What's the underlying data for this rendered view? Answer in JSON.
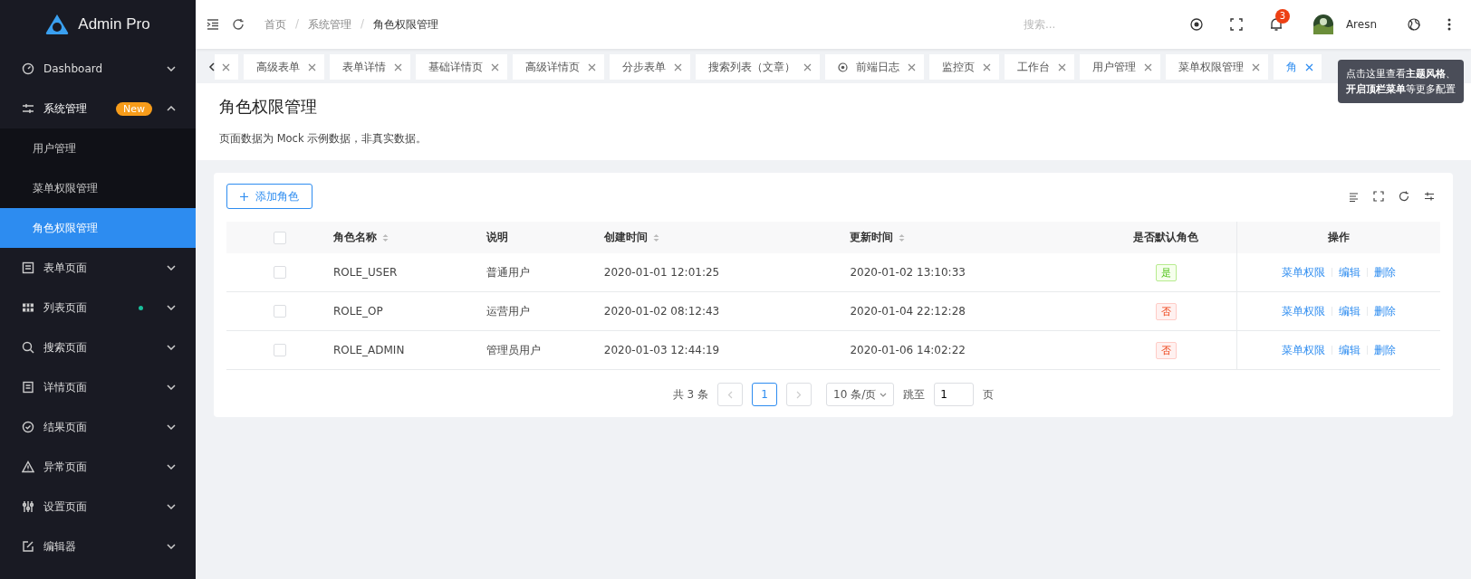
{
  "sidebar": {
    "logo": "Admin Pro",
    "items": [
      {
        "label": "Dashboard",
        "expanded": false
      },
      {
        "label": "系统管理",
        "expanded": true,
        "badge": "New",
        "children": [
          {
            "label": "用户管理",
            "selected": false
          },
          {
            "label": "菜单权限管理",
            "selected": false
          },
          {
            "label": "角色权限管理",
            "selected": true
          }
        ]
      },
      {
        "label": "表单页面",
        "expanded": false
      },
      {
        "label": "列表页面",
        "expanded": false,
        "dot": true
      },
      {
        "label": "搜索页面",
        "expanded": false
      },
      {
        "label": "详情页面",
        "expanded": false
      },
      {
        "label": "结果页面",
        "expanded": false
      },
      {
        "label": "异常页面",
        "expanded": false
      },
      {
        "label": "设置页面",
        "expanded": false
      },
      {
        "label": "编辑器",
        "expanded": false
      }
    ]
  },
  "header": {
    "breadcrumb_separator": "/",
    "breadcrumb": [
      "首页",
      "系统管理",
      "角色权限管理"
    ],
    "search": {
      "placeholder": "搜索..."
    },
    "notification_count": "3",
    "user": "Aresn"
  },
  "tabs": [
    {
      "selected": false
    },
    {
      "label": "高级表单",
      "selected": false
    },
    {
      "label": "表单详情",
      "selected": false
    },
    {
      "label": "基础详情页",
      "selected": false
    },
    {
      "label": "高级详情页",
      "selected": false
    },
    {
      "label": "分步表单",
      "selected": false
    },
    {
      "label": "搜索列表（文章）",
      "selected": false
    },
    {
      "label": "前端日志",
      "selected": false,
      "dot": true
    },
    {
      "label": "监控页",
      "selected": false
    },
    {
      "label": "工作台",
      "selected": false
    },
    {
      "label": "用户管理",
      "selected": false
    },
    {
      "label": "菜单权限管理",
      "selected": false
    },
    {
      "label": "角",
      "selected": true
    }
  ],
  "tooltip": {
    "lines": [
      "点击这里查看**主题风格**、",
      "**开启顶栏菜单**等更多配置"
    ]
  },
  "page": {
    "title": "角色权限管理",
    "description": "页面数据为 Mock 示例数据，非真实数据。"
  },
  "add_button": "添加角色",
  "table": {
    "all_checked": false,
    "columns": [
      {
        "label": "角色名称",
        "sortable": true
      },
      {
        "label": "说明",
        "sortable": false
      },
      {
        "label": "创建时间",
        "sortable": true
      },
      {
        "label": "更新时间",
        "sortable": true
      },
      {
        "label": "是否默认角色",
        "sortable": false
      },
      {
        "label": "操作",
        "sortable": false
      }
    ],
    "rows": [
      {
        "checked": false,
        "name": "ROLE_USER",
        "description": "普通用户",
        "created": "2020-01-01 12:01:25",
        "updated": "2020-01-02 13:10:33",
        "default": {
          "text": "是",
          "on": true
        },
        "actions": [
          "菜单权限",
          "编辑",
          "删除"
        ]
      },
      {
        "checked": false,
        "name": "ROLE_OP",
        "description": "运营用户",
        "created": "2020-01-02 08:12:43",
        "updated": "2020-01-04 22:12:28",
        "default": {
          "text": "否",
          "on": false
        },
        "actions": [
          "菜单权限",
          "编辑",
          "删除"
        ]
      },
      {
        "checked": false,
        "name": "ROLE_ADMIN",
        "description": "管理员用户",
        "created": "2020-01-03 12:44:19",
        "updated": "2020-01-06 14:02:22",
        "default": {
          "text": "否",
          "on": false
        },
        "actions": [
          "菜单权限",
          "编辑",
          "删除"
        ]
      }
    ]
  },
  "pagination": {
    "total": "共 3 条",
    "pages": [
      {
        "label": "1",
        "selected": true
      }
    ],
    "page_size": "10 条/页",
    "jump_label": "跳至",
    "jump_value": "1",
    "jump_suffix": "页"
  }
}
